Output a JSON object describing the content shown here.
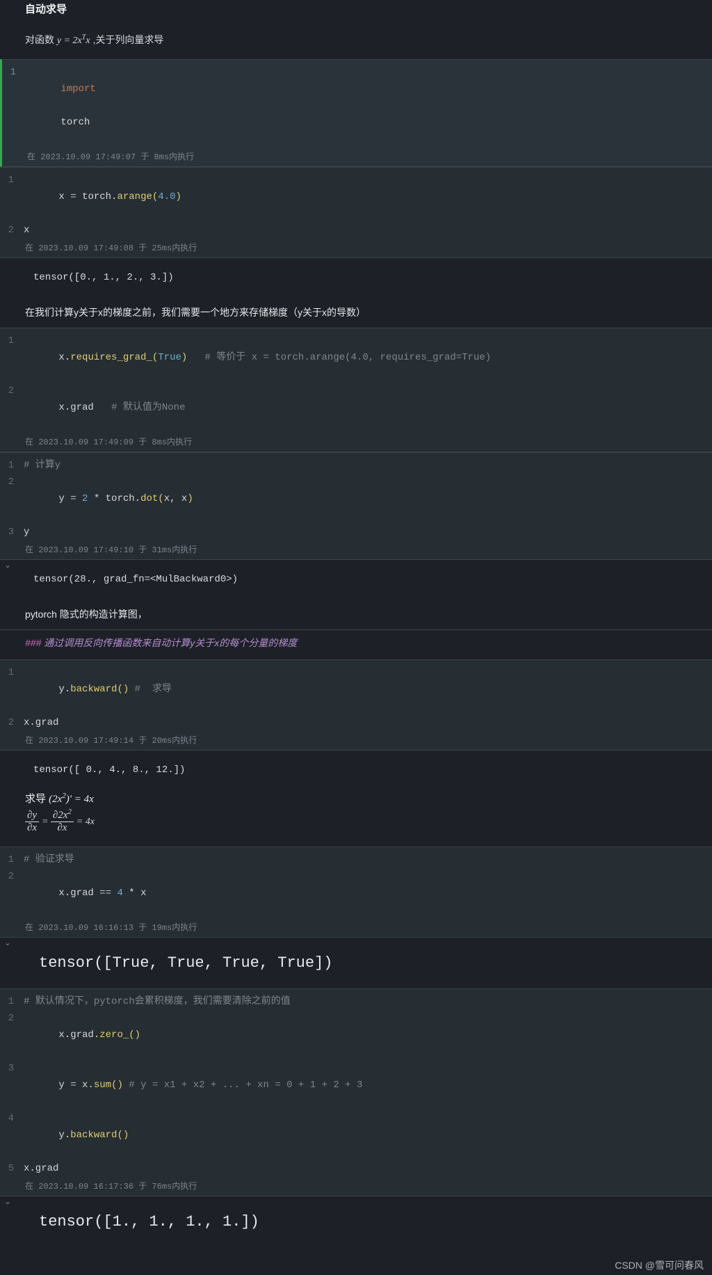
{
  "heading": "自动求导",
  "intro": {
    "pre": "对函数 ",
    "expr": "y = 2xᵀx",
    "post": " ,关于列向量求导"
  },
  "blocks": [
    {
      "lines": [
        {
          "n": "1",
          "import_kw": "import",
          "module": "torch"
        }
      ],
      "tstamp": "在 2023.10.09 17:49:07 于 8ms内执行",
      "highlight": true
    },
    {
      "lines": [
        {
          "n": "1",
          "lhs": "x ",
          "eq": "= ",
          "obj": "torch.",
          "fn": "arange",
          "open": "(",
          "arg": "4.0",
          "close": ")"
        },
        {
          "n": "2",
          "plain": "x"
        }
      ],
      "tstamp": "在 2023.10.09 17:49:08 于 25ms内执行"
    }
  ],
  "out1": "tensor([0., 1., 2., 3.])",
  "para1": "在我们计算y关于x的梯度之前，我们需要一个地方来存储梯度（y关于x的导数）",
  "block3": {
    "lines": [
      {
        "n": "1",
        "pre": "x.",
        "fn": "requires_grad_",
        "open": "(",
        "bool": "True",
        "close": ")",
        "sp": "   ",
        "cmt": "# 等价于 x = torch.arange(4.0, requires_grad=True)"
      },
      {
        "n": "2",
        "plain": "x.grad",
        "sp": "   ",
        "cmt": "# 默认值为None"
      }
    ],
    "tstamp": "在 2023.10.09 17:49:09 于 8ms内执行"
  },
  "block4": {
    "lines": [
      {
        "n": "1",
        "cmt": "# 计算y"
      },
      {
        "n": "2",
        "pre": "y ",
        "eq": "= ",
        "num": "2",
        "mid": " * torch.",
        "fn": "dot",
        "open": "(",
        "args": "x, x",
        "close": ")"
      },
      {
        "n": "3",
        "plain": "y"
      }
    ],
    "tstamp": "在 2023.10.09 17:49:10 于 31ms内执行"
  },
  "out2": "tensor(28., grad_fn=<MulBackward0>)",
  "para2": "pytorch  隐式的构造计算图，",
  "mdheading": {
    "hash": "###",
    "text": "  通过调用反向传播函数来自动计算y关于x的每个分量的梯度"
  },
  "block5": {
    "lines": [
      {
        "n": "1",
        "pre": "y.",
        "fn": "backward",
        "open": "(",
        "close": ")",
        "sp": " ",
        "cmt": "#  求导"
      },
      {
        "n": "2",
        "plain": "x.grad"
      }
    ],
    "tstamp": "在 2023.10.09 17:49:14 于 20ms内执行"
  },
  "out3": "tensor([ 0.,  4.,  8., 12.])",
  "mathline1_label": "求导 ",
  "block6": {
    "lines": [
      {
        "n": "1",
        "cmt": "# 验证求导"
      },
      {
        "n": "2",
        "pre": "x.grad ",
        "eq": "== ",
        "num": "4",
        "post": " * x"
      }
    ],
    "tstamp": "在 2023.10.09 16:16:13 于 19ms内执行"
  },
  "out4": "tensor([True, True, True, True])",
  "block7": {
    "lines": [
      {
        "n": "1",
        "cmt": "# 默认情况下，pytorch会累积梯度，我们需要清除之前的值"
      },
      {
        "n": "2",
        "pre": "x.grad.",
        "fn": "zero_",
        "open": "(",
        "close": ")"
      },
      {
        "n": "3",
        "pre": "y ",
        "eq": "= ",
        "obj": "x.",
        "fn": "sum",
        "open": "(",
        "close": ")",
        "sp": " ",
        "cmt": "# y = x1 + x2 + ... + xn = 0 + 1 + 2 + 3"
      },
      {
        "n": "4",
        "pre": "y.",
        "fn": "backward",
        "open": "(",
        "close": ")"
      },
      {
        "n": "5",
        "plain": "x.grad"
      }
    ],
    "tstamp": "在 2023.10.09 16:17:36 于 76ms内执行"
  },
  "out5": "tensor([1., 1., 1., 1.])",
  "watermark": "CSDN @雪可问春风"
}
